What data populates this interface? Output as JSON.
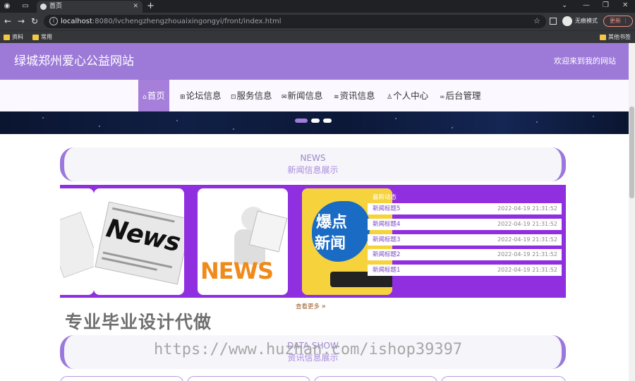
{
  "browser": {
    "tab_title": "首页",
    "new_tab_symbol": "+",
    "url_host": "localhost",
    "url_rest": ":8080/lvchengzhengzhouaixingongyi/front/index.html",
    "profile_label": "无痕模式",
    "update_label": "更新",
    "bookmarks": [
      "资料",
      "常用"
    ],
    "other_bookmarks": "其他书签"
  },
  "header": {
    "site_title": "绿城郑州爱心公益网站",
    "welcome": "欢迎来到我的网站"
  },
  "nav": {
    "items": [
      {
        "label": "首页",
        "icon": "home-icon",
        "active": true
      },
      {
        "label": "论坛信息",
        "icon": "grid-icon",
        "active": false
      },
      {
        "label": "服务信息",
        "icon": "service-icon",
        "active": false
      },
      {
        "label": "新闻信息",
        "icon": "mail-icon",
        "active": false
      },
      {
        "label": "资讯信息",
        "icon": "layers-icon",
        "active": false
      },
      {
        "label": "个人中心",
        "icon": "user-icon",
        "active": false
      },
      {
        "label": "后台管理",
        "icon": "link-icon",
        "active": false
      }
    ]
  },
  "news_section": {
    "title_en": "NEWS",
    "title_cn": "新闻信息展示",
    "photo_news_label": "News",
    "photo_news_orange": "NEWS",
    "photo_burst_line1": "爆点",
    "photo_burst_line2": "新闻",
    "latest_label": "最新动态",
    "items": [
      {
        "title": "新闻标题5",
        "date": "2022-04-19 21:31:52"
      },
      {
        "title": "新闻标题4",
        "date": "2022-04-19 21:31:52"
      },
      {
        "title": "新闻标题3",
        "date": "2022-04-19 21:31:52"
      },
      {
        "title": "新闻标题2",
        "date": "2022-04-19 21:31:52"
      },
      {
        "title": "新闻标题1",
        "date": "2022-04-19 21:31:52"
      }
    ],
    "more_label": "查看更多"
  },
  "data_section": {
    "title_en": "DATA SHOW",
    "title_cn": "资讯信息展示"
  },
  "overlay": {
    "ad_text": "专业毕业设计代做",
    "watermark": "https://www.huzhan.com/ishop39397"
  },
  "colors": {
    "header_purple": "#9d7ad8",
    "band_purple": "#8f2fe0",
    "nav_active": "#a57fd9"
  }
}
